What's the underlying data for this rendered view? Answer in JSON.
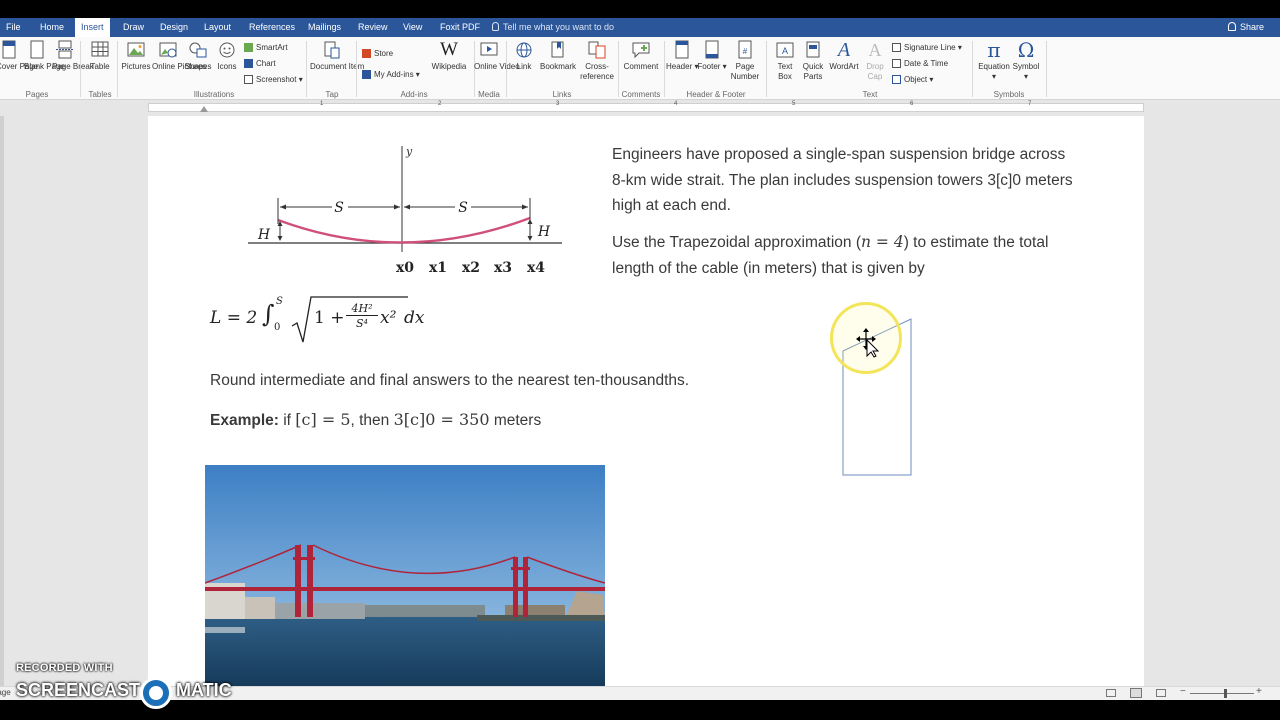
{
  "app": {
    "tabs": [
      "File",
      "Home",
      "Insert",
      "Draw",
      "Design",
      "Layout",
      "References",
      "Mailings",
      "Review",
      "View",
      "Foxit PDF"
    ],
    "active_tab": "Insert",
    "tell_me": "Tell me what you want to do",
    "share": "Share"
  },
  "ribbon": {
    "buttons": {
      "cover_page": "Cover Page",
      "blank_page": "Blank Page",
      "page_break": "Page Break",
      "table": "Table",
      "pictures": "Pictures",
      "online_pictures": "Online Pictures",
      "shapes": "Shapes",
      "icons": "Icons",
      "document_item": "Document Item",
      "wikipedia": "Wikipedia",
      "online_video": "Online Video",
      "link": "Link",
      "bookmark": "Bookmark",
      "cross_reference": "Cross-reference",
      "comment": "Comment",
      "header": "Header",
      "footer": "Footer",
      "page_number": "Page Number",
      "text_box": "Text Box",
      "quick_parts": "Quick Parts",
      "wordart": "WordArt",
      "drop_cap": "Drop Cap",
      "equation": "Equation",
      "symbol": "Symbol"
    },
    "small": {
      "smartart": "SmartArt",
      "chart": "Chart",
      "screenshot": "Screenshot",
      "store": "Store",
      "my_addins": "My Add-ins",
      "signature_line": "Signature Line",
      "date_time": "Date & Time",
      "object": "Object"
    },
    "groups": {
      "pages": "Pages",
      "tables": "Tables",
      "illustrations": "Illustrations",
      "tap": "Tap",
      "addins": "Add-ins",
      "media": "Media",
      "links": "Links",
      "comments": "Comments",
      "header_footer": "Header & Footer",
      "text": "Text",
      "symbols": "Symbols"
    }
  },
  "ruler": {
    "numbers": [
      "1",
      "2",
      "3",
      "4",
      "5",
      "6",
      "7"
    ]
  },
  "diagram": {
    "y_label": "y",
    "s_left": "S",
    "s_right": "S",
    "h_left": "H",
    "h_right": "H",
    "x_labels": [
      "x0",
      "x1",
      "x2",
      "x3",
      "x4"
    ]
  },
  "doc": {
    "intro": "Engineers have proposed a single-span suspension bridge across 8-km wide strait. The plan includes suspension towers 3[c]0 meters high at each end.",
    "trap_before": "Use the Trapezoidal approximation (",
    "trap_math": "n = 4",
    "trap_after": ") to estimate the total length of the cable (in meters) that is given by",
    "formula": {
      "lhs": "L = 2",
      "int_upper": "S",
      "int_lower": "0",
      "radicand_a": "1 + ",
      "num": "4H²",
      "den": "S⁴",
      "radicand_b": "x²",
      "dx": "dx"
    },
    "rounding": "Round intermediate and final answers to the nearest ten-thousandths.",
    "example_label": "Example:",
    "example_if": " if ",
    "example_math1": "[c] = 5",
    "example_then": ", then ",
    "example_math2": "3[c]0 = 350",
    "example_units": " meters"
  },
  "watermark": {
    "line1": "RECORDED WITH",
    "brand_a": "SCREENCAST",
    "brand_b": "MATIC"
  },
  "status": {
    "page_label": "Page"
  },
  "colors": {
    "accent": "#2b579a",
    "cable": "#d0507a",
    "highlight": "#f2e55a"
  }
}
